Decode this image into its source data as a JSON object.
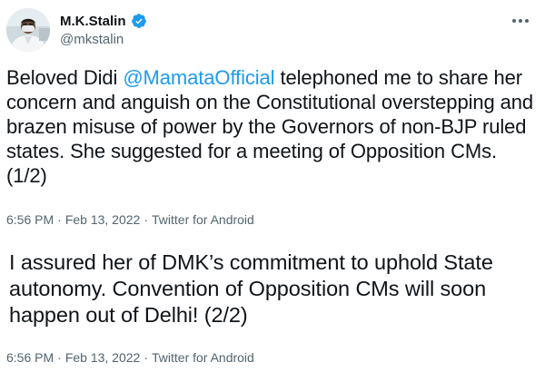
{
  "tweet1": {
    "author": {
      "display_name": "M.K.Stalin",
      "handle": "@mkstalin",
      "verified": true,
      "avatar_icon": "profile-photo"
    },
    "more_icon": "more-horizontal-icon",
    "text": {
      "before_mention": "Beloved Didi ",
      "mention": "@MamataOfficial",
      "after_mention": " telephoned me to share her concern and anguish on the Constitutional overstepping and brazen misuse of power by the Governors of non-BJP ruled states. She suggested for a meeting of Opposition CMs. (1/2)"
    },
    "meta": {
      "time": "6:56 PM",
      "separator": "·",
      "date": "Feb 13, 2022",
      "source": "Twitter for Android"
    }
  },
  "tweet2": {
    "text": "I assured her of DMK’s commitment to uphold State autonomy. Convention of Opposition CMs will soon happen out of Delhi! (2/2)",
    "meta": {
      "time": "6:56 PM",
      "separator": "·",
      "date": "Feb 13, 2022",
      "source": "Twitter for Android"
    }
  },
  "colors": {
    "text": "#0f1419",
    "secondary": "#536471",
    "link": "#1d9bf0",
    "verified": "#1d9bf0"
  }
}
